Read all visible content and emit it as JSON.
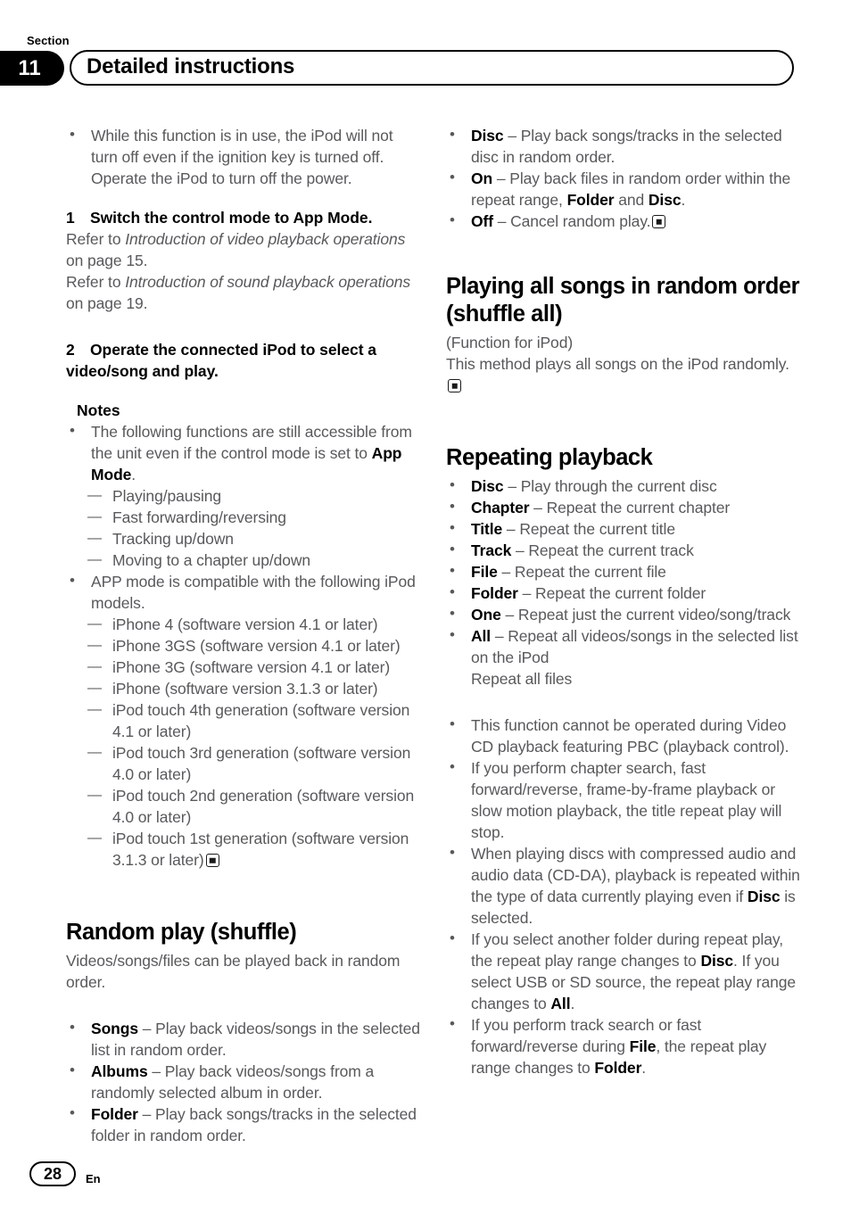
{
  "header": {
    "section_label": "Section",
    "section_number": "11",
    "title": "Detailed instructions"
  },
  "footer": {
    "page_number": "28",
    "language": "En"
  },
  "left_column": {
    "intro_note": {
      "bullet": "While this function is in use, the iPod will not turn off even if the ignition key is turned off. Operate the iPod to turn off the power."
    },
    "step1": {
      "number": "1",
      "title": "Switch the control mode to App Mode.",
      "refer_1_pre": "Refer to ",
      "refer_1_italic": "Introduction of video playback operations",
      "refer_1_post": " on page 15.",
      "refer_2_pre": "Refer to ",
      "refer_2_italic": "Introduction of sound playback operations",
      "refer_2_post": " on page 19."
    },
    "step2": {
      "number": "2",
      "title": "Operate the connected iPod to select a video/song and play."
    },
    "notes": {
      "heading": "Notes",
      "note1_pre": "The following functions are still accessible from the unit even if the control mode is set to ",
      "note1_bold": "App Mode",
      "note1_post": ".",
      "note1_items": [
        "Playing/pausing",
        "Fast forwarding/reversing",
        "Tracking up/down",
        "Moving to a chapter up/down"
      ],
      "note2": "APP mode is compatible with the following iPod models.",
      "note2_items": [
        "iPhone 4 (software version 4.1 or later)",
        "iPhone 3GS (software version 4.1 or later)",
        "iPhone 3G (software version 4.1 or later)",
        "iPhone (software version 3.1.3 or later)",
        "iPod touch 4th generation (software version 4.1 or later)",
        "iPod touch 3rd generation (software version 4.0 or later)",
        "iPod touch 2nd generation (software version 4.0 or later)",
        "iPod touch 1st generation (software version 3.1.3 or later)"
      ]
    },
    "random_play": {
      "title": "Random play (shuffle)",
      "intro": "Videos/songs/files can be played back in random order.",
      "items": [
        {
          "term": "Songs",
          "desc": " – Play back videos/songs in the selected list in random order."
        },
        {
          "term": "Albums",
          "desc": " – Play back videos/songs from a randomly selected album in order."
        },
        {
          "term": "Folder",
          "desc": " – Play back songs/tracks in the selected folder in random order."
        }
      ]
    }
  },
  "right_column": {
    "random_play_cont": {
      "items": [
        {
          "term": "Disc",
          "desc": " – Play back songs/tracks in the selected disc in random order."
        },
        {
          "term": "On",
          "desc_pre": " – Play back files in random order within the repeat range, ",
          "bold_1": "Folder",
          "mid": " and ",
          "bold_2": "Disc",
          "desc_post": "."
        },
        {
          "term": "Off",
          "desc": " – Cancel random play."
        }
      ]
    },
    "shuffle_all": {
      "title": "Playing all songs in random order (shuffle all)",
      "function_for": "(Function for iPod)",
      "body": "This method plays all songs on the iPod randomly."
    },
    "repeating_playback": {
      "title": "Repeating playback",
      "items": [
        {
          "term": "Disc",
          "desc": " – Play through the current disc"
        },
        {
          "term": "Chapter",
          "desc": " – Repeat the current chapter"
        },
        {
          "term": "Title",
          "desc": " – Repeat the current title"
        },
        {
          "term": "Track",
          "desc": " – Repeat the current track"
        },
        {
          "term": "File",
          "desc": " – Repeat the current file"
        },
        {
          "term": "Folder",
          "desc": " – Repeat the current folder"
        },
        {
          "term": "One",
          "desc": " – Repeat just the current video/song/track"
        },
        {
          "term": "All",
          "desc": " – Repeat all videos/songs in the selected list on the iPod"
        }
      ],
      "extra_line": "Repeat all files",
      "notes": [
        {
          "text": "This function cannot be operated during Video CD playback featuring PBC (playback control)."
        },
        {
          "text": "If you perform chapter search, fast forward/reverse, frame-by-frame playback or slow motion playback, the title repeat play will stop."
        },
        {
          "pre": "When playing discs with compressed audio and audio data (CD-DA), playback is repeated within the type of data currently playing even if ",
          "bold_1": "Disc",
          "post": " is selected."
        },
        {
          "pre": "If you select another folder during repeat play, the repeat play range changes to ",
          "bold_1": "Disc",
          "mid": ". If you select USB or SD source, the repeat play range changes to ",
          "bold_2": "All",
          "post": "."
        },
        {
          "pre": "If you perform track search or fast forward/reverse during ",
          "bold_1": "File",
          "mid": ", the repeat play range changes to ",
          "bold_2": "Folder",
          "post": "."
        }
      ]
    }
  }
}
